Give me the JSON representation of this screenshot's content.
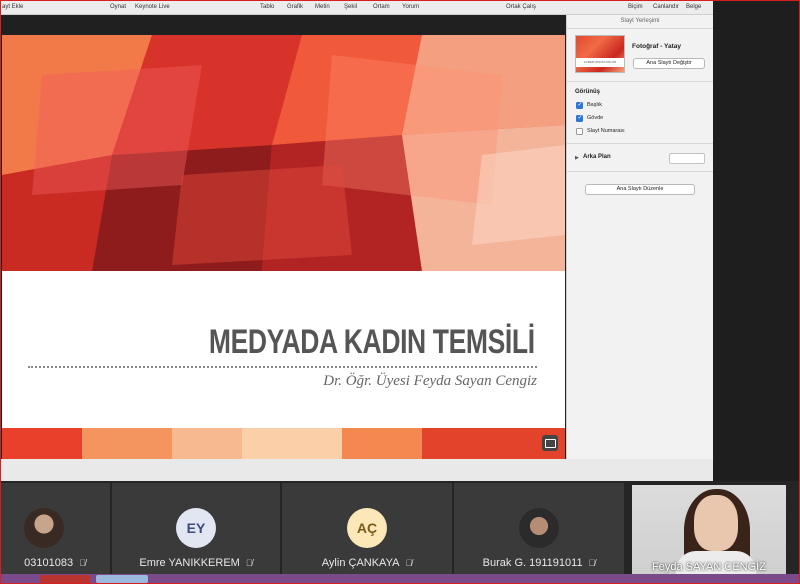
{
  "toolbar": {
    "items": [
      "ayt Ekle",
      "Oynat",
      "Keynote Live",
      "Tablo",
      "Grafik",
      "Metin",
      "Şekil",
      "Ortam",
      "Yorum",
      "Ortak Çalış",
      "Biçim",
      "Canlandır",
      "Belge"
    ]
  },
  "inspector": {
    "title": "Slayt Yerleşimi",
    "master_name": "Fotoğraf - Yatay",
    "thumb_caption": "LOREM IPSUM DOLOR",
    "change_master_label": "Ana Slaytı Değiştir",
    "appearance_label": "Görünüş",
    "checkboxes": [
      {
        "label": "Başlık",
        "checked": true
      },
      {
        "label": "Gövde",
        "checked": true
      },
      {
        "label": "Slayt Numarası",
        "checked": false
      }
    ],
    "background_label": "Arka Plan",
    "edit_master_label": "Ana Slaytı Düzenle"
  },
  "slide": {
    "title": "MEDYADA KADIN TEMSİLİ",
    "subtitle": "Dr. Öğr. Üyesi Feyda Sayan Cengiz"
  },
  "participants": [
    {
      "name": "03101083",
      "avatar": "photo"
    },
    {
      "name": "Emre YANIKKEREM",
      "initials": "EY"
    },
    {
      "name": "Aylin ÇANKAYA",
      "initials": "AÇ"
    },
    {
      "name": "Burak G. 191191011",
      "avatar": "photo"
    },
    {
      "name": "Feyda SAYAN CENGİZ",
      "avatar": "video"
    }
  ]
}
